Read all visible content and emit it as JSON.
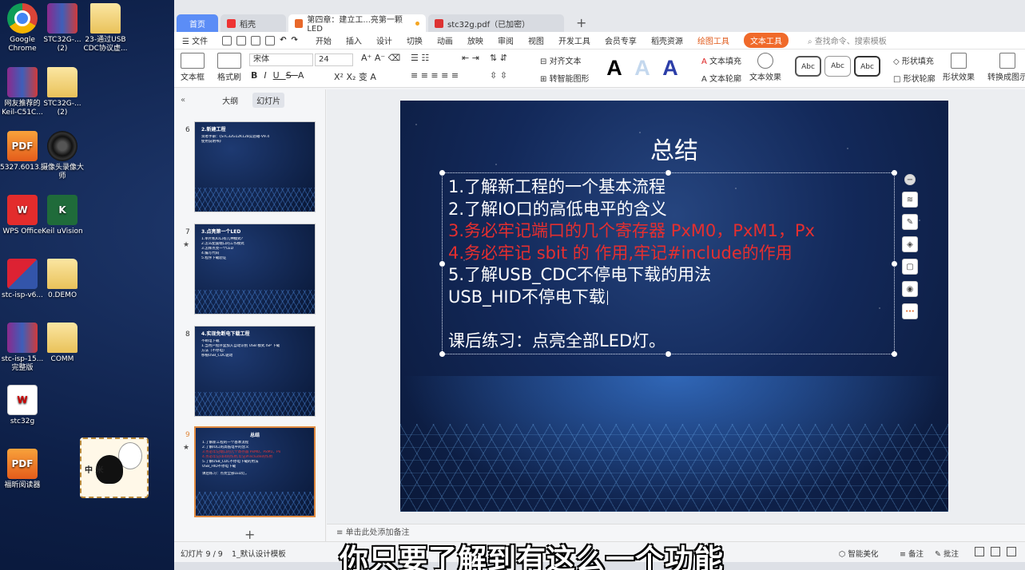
{
  "desktop": {
    "icons": [
      {
        "label": "Google Chrome",
        "icon": "chrome-icon"
      },
      {
        "label": "STC32G-...(2)",
        "icon": "winrar-icon"
      },
      {
        "label": "23-通过USB CDC协议虚...",
        "icon": "folder-icon"
      },
      {
        "label": "网友推荐的Keil-C51C...",
        "icon": "winrar-icon"
      },
      {
        "label": "STC32G-...(2)",
        "icon": "folder-icon"
      },
      {
        "label": "5327.6013...",
        "icon": "pdf-icon"
      },
      {
        "label": "摄像头录像大师",
        "icon": "camera-icon"
      },
      {
        "label": "WPS Office",
        "icon": "wps-icon"
      },
      {
        "label": "Keil uVision",
        "icon": "keil-icon"
      },
      {
        "label": "stc-isp-v6...",
        "icon": "stc-isp-icon"
      },
      {
        "label": "0.DEMO",
        "icon": "folder-icon"
      },
      {
        "label": "stc-isp-15...完整版",
        "icon": "winrar-icon"
      },
      {
        "label": "COMM",
        "icon": "folder-icon"
      },
      {
        "label": "stc32g",
        "icon": "document-icon"
      },
      {
        "label": "福昕阅读器",
        "icon": "pdf-icon"
      }
    ],
    "mascot_sign": "中 米"
  },
  "tabs": [
    {
      "label": "首页"
    },
    {
      "label": "稻壳"
    },
    {
      "label": "第四章：建立工...亮第一颗LED"
    },
    {
      "label": "stc32g.pdf（已加密）"
    }
  ],
  "menu": {
    "file": "文件",
    "items": [
      "开始",
      "插入",
      "设计",
      "切换",
      "动画",
      "放映",
      "审阅",
      "视图",
      "开发工具",
      "会员专享",
      "稻壳资源"
    ],
    "drawing_tools": "绘图工具",
    "text_tools": "文本工具",
    "search_placeholder": "查找命令、搜索模板"
  },
  "ribbon": {
    "textbox": "文本框",
    "format_painter": "格式刷",
    "font_name": "宋体",
    "font_size": "24",
    "align_text": "对齐文本",
    "smart_art": "转智能图形",
    "text_fill": "文本填充",
    "text_outline": "文本轮廓",
    "text_effect": "文本效果",
    "shape_fill": "形状填充",
    "shape_outline": "形状轮廓",
    "shape_effect": "形状效果",
    "convert_image": "转换成图示",
    "style_sample": "Abc"
  },
  "leftpanel": {
    "outline_tab": "大纲",
    "slides_tab": "幻灯片",
    "thumbs": [
      {
        "num": "6",
        "title": "2.新建工程",
        "lines": [
          "资者手册：《STC32G12K128实验箱-V9.4",
          "使用说明书》"
        ],
        "red_lines": []
      },
      {
        "num": "7",
        "title": "3.点亮第一个LED",
        "lines": [
          "1.单片机IO口有几种模式？",
          "2.怎么配置端口的工作模式",
          "3.怎样点亮一个LED",
          "4.编写代码",
          "5.程序下载验证"
        ],
        "red_lines": []
      },
      {
        "num": "8",
        "title": "4.实现免断电下载工程",
        "lines": [
          "不断电下载",
          "1.当用户程序里加入自动识别 USB 模式 ISP 下载",
          "方法（不停电）",
          "移植USB_CDC驱动"
        ],
        "red_lines": []
      },
      {
        "num": "9",
        "title": "总结",
        "lines": [
          "1.了解新工程的一个基本流程",
          "2.了解IO口的高低电平的含义",
          "5.了解USB_CDC不停电下载的用法",
          "USB_HID不停电下载",
          "课后练习：点亮全部LED灯。"
        ],
        "red_lines": [
          "3.务必牢记端口的几个寄存器 PxM0，PxM1，Px",
          "4.务必牢记sbit的作用,牢记#include的作用"
        ]
      }
    ]
  },
  "slide": {
    "title": "总结",
    "line1": "1.了解新工程的一个基本流程",
    "line2": "2.了解IO口的高低电平的含义",
    "line3": "3.务必牢记端口的几个寄存器 PxM0，PxM1，Px",
    "line4": "4.务必牢记 sbit 的 作用,牢记#include的作用",
    "line5": "5.了解USB_CDC不停电下载的用法",
    "line6": "USB_HID不停电下载",
    "line7": "课后练习：点亮全部LED灯。",
    "colors": {
      "text": "#ffffff",
      "highlight": "#e52f2f"
    }
  },
  "notes_placeholder": "单击此处添加备注",
  "status": {
    "slide_counter": "幻灯片 9 / 9",
    "theme": "1_默认设计模板",
    "smart_beautify": "智能美化",
    "notes": "备注",
    "comments": "批注"
  },
  "subtitle": "你只要了解到有这么一个功能"
}
